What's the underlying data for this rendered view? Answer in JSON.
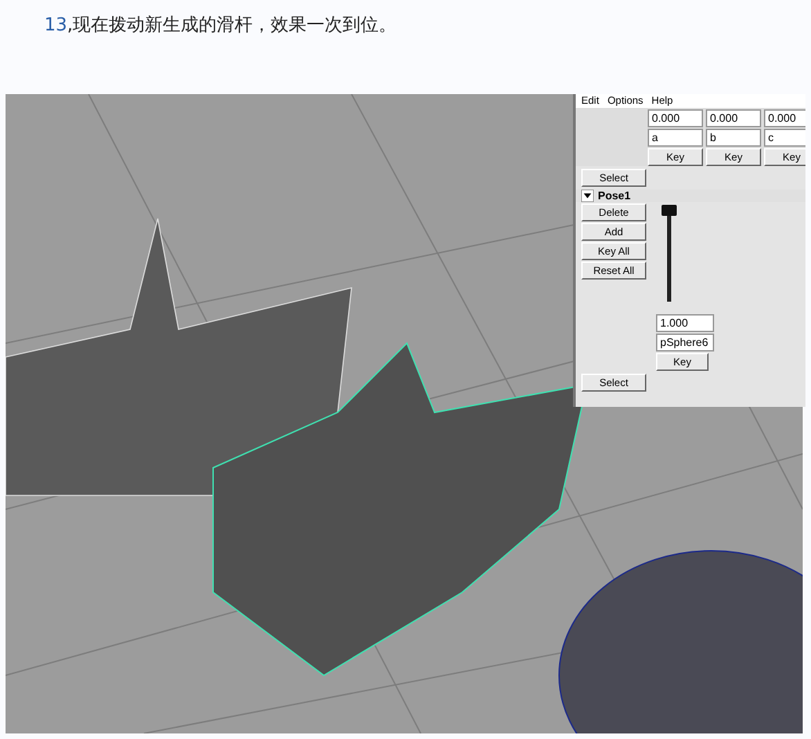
{
  "caption": {
    "number": "13",
    "text": ",现在拨动新生成的滑杆，效果一次到位。"
  },
  "panel": {
    "menu": [
      "Edit",
      "Options",
      "Help"
    ],
    "targets": [
      {
        "weight": "0.000",
        "name": "a",
        "key": "Key"
      },
      {
        "weight": "0.000",
        "name": "b",
        "key": "Key"
      },
      {
        "weight": "0.000",
        "name": "c",
        "key": "Key"
      }
    ],
    "select_top": "Select",
    "pose": {
      "name": "Pose1",
      "expanded": true,
      "buttons": [
        "Delete",
        "Add",
        "Key All",
        "Reset All"
      ],
      "slider": {
        "level": 1
      },
      "weight": "1.000",
      "target": "pSphere6",
      "key": "Key"
    },
    "select_bottom": "Select"
  }
}
